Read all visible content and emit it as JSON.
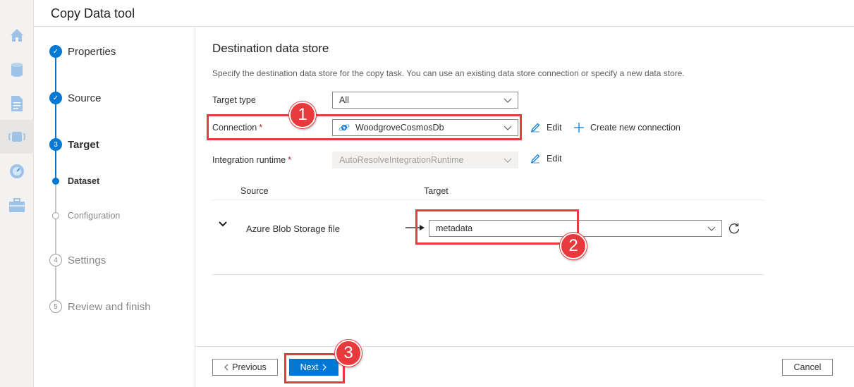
{
  "app": {
    "title": "Copy Data tool"
  },
  "rail": {
    "icons": [
      "home-icon",
      "database-icon",
      "document-icon",
      "monitor-icon",
      "gauge-icon",
      "toolbox-icon"
    ]
  },
  "steps": [
    {
      "label": "Properties",
      "state": "done",
      "marker": "✓"
    },
    {
      "label": "Source",
      "state": "done",
      "marker": "✓"
    },
    {
      "label": "Target",
      "state": "current",
      "marker": "3"
    },
    {
      "label": "Dataset",
      "state": "sub-current"
    },
    {
      "label": "Configuration",
      "state": "sub-todo"
    },
    {
      "label": "Settings",
      "state": "todo",
      "marker": "4"
    },
    {
      "label": "Review and finish",
      "state": "todo",
      "marker": "5"
    }
  ],
  "main": {
    "title": "Destination data store",
    "description": "Specify the destination data store for the copy task. You can use an existing data store connection or specify a new data store.",
    "target_type": {
      "label": "Target type",
      "value": "All"
    },
    "connection": {
      "label": "Connection",
      "required": "*",
      "value": "WoodgroveCosmosDb",
      "edit": "Edit",
      "create": "Create new connection"
    },
    "runtime": {
      "label": "Integration runtime",
      "required": "*",
      "value": "AutoResolveIntegrationRuntime",
      "edit": "Edit"
    },
    "mapping": {
      "source_header": "Source",
      "target_header": "Target",
      "rows": [
        {
          "source": "Azure Blob Storage file",
          "target": "metadata"
        }
      ]
    }
  },
  "footer": {
    "previous": "Previous",
    "next": "Next",
    "cancel": "Cancel"
  },
  "callouts": [
    "1",
    "2",
    "3"
  ],
  "colors": {
    "accent": "#0078d4",
    "callout": "#e8393d",
    "required": "#a4262c"
  }
}
